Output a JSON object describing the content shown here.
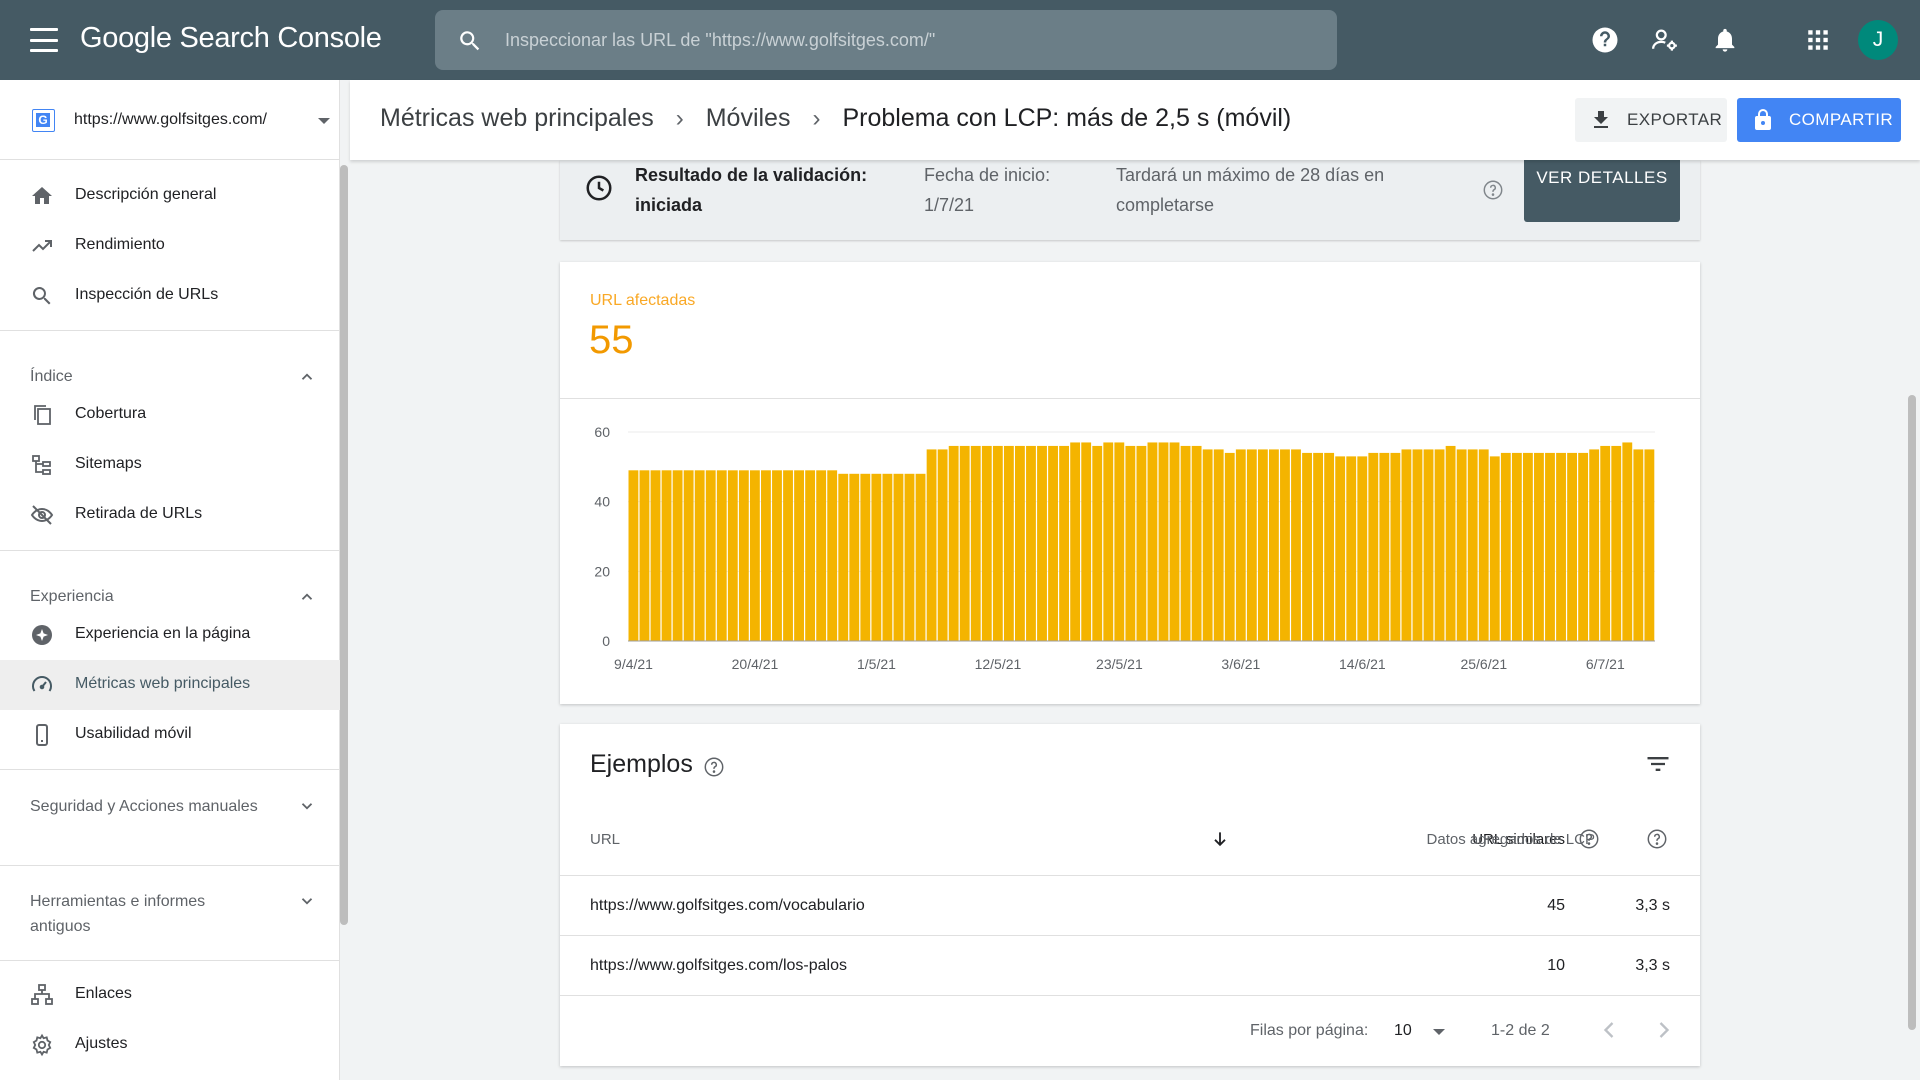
{
  "app": {
    "logo_text": "Google Search Console",
    "search_placeholder": "Inspeccionar las URL de \"https://www.golfsitges.com/\"",
    "avatar_letter": "J"
  },
  "icons": {
    "menu": "menu-icon",
    "search": "search-icon",
    "help": "help-icon",
    "user_settings": "manage-accounts-icon",
    "notifications": "bell-icon",
    "apps": "apps-grid-icon"
  },
  "sidebar": {
    "property_url": "https://www.golfsitges.com/",
    "property_icon_letter": "G",
    "top_items": [
      {
        "label": "Descripción general",
        "icon": "home-icon"
      },
      {
        "label": "Rendimiento",
        "icon": "trending-up-icon"
      },
      {
        "label": "Inspección de URLs",
        "icon": "search-icon"
      }
    ],
    "sections": [
      {
        "label": "Índice",
        "expanded": true
      },
      {
        "label": "Experiencia",
        "expanded": true
      },
      {
        "label": "Seguridad y Acciones manuales",
        "expanded": false
      },
      {
        "label": "Herramientas e informes antiguos",
        "expanded": false
      }
    ],
    "index_items": [
      {
        "label": "Cobertura",
        "icon": "copy-pages-icon"
      },
      {
        "label": "Sitemaps",
        "icon": "sitemap-icon"
      },
      {
        "label": "Retirada de URLs",
        "icon": "visibility-off-icon"
      }
    ],
    "experience_items": [
      {
        "label": "Experiencia en la página",
        "icon": "plus-circle-icon"
      },
      {
        "label": "Métricas web principales",
        "icon": "speedometer-icon",
        "active": true
      },
      {
        "label": "Usabilidad móvil",
        "icon": "smartphone-icon"
      }
    ],
    "bottom_items": [
      {
        "label": "Enlaces",
        "icon": "links-tree-icon"
      },
      {
        "label": "Ajustes",
        "icon": "settings-gear-icon"
      }
    ]
  },
  "header": {
    "breadcrumbs": [
      "Métricas web principales",
      "Móviles"
    ],
    "current": "Problema con LCP: más de 2,5 s (móvil)",
    "export_label": "EXPORTAR",
    "share_label": "COMPARTIR"
  },
  "validation": {
    "result_label": "Resultado de la validación: iniciada",
    "start_date_label": "Fecha de inicio: 1/7/21",
    "duration_text": "Tardará un máximo de 28 días en completarse",
    "details_button": "VER DETALLES"
  },
  "metric": {
    "label": "URL afectadas",
    "value": "55"
  },
  "colors": {
    "appbar": "#455a64",
    "bar": "#f4b400",
    "metric_value": "#f29900",
    "share_button": "#4285f4"
  },
  "chart_data": {
    "type": "bar",
    "ylim": [
      0,
      60
    ],
    "yticks": [
      0,
      20,
      40,
      60
    ],
    "xtick_labels": [
      "9/4/21",
      "20/4/21",
      "1/5/21",
      "12/5/21",
      "23/5/21",
      "3/6/21",
      "14/6/21",
      "25/6/21",
      "6/7/21"
    ],
    "xtick_indices": [
      0,
      11,
      22,
      33,
      44,
      55,
      66,
      77,
      88
    ],
    "series": [
      {
        "values": [
          49,
          49,
          49,
          49,
          49,
          49,
          49,
          49,
          49,
          49,
          49,
          49,
          49,
          49,
          49,
          49,
          49,
          49,
          49,
          48,
          48,
          48,
          48,
          48,
          48,
          48,
          48,
          55,
          55,
          56,
          56,
          56,
          56,
          56,
          56,
          56,
          56,
          56,
          56,
          56,
          57,
          57,
          56,
          57,
          57,
          56,
          56,
          57,
          57,
          57,
          56,
          56,
          55,
          55,
          54,
          55,
          55,
          55,
          55,
          55,
          55,
          54,
          54,
          54,
          53,
          53,
          53,
          54,
          54,
          54,
          55,
          55,
          55,
          55,
          56,
          55,
          55,
          55,
          53,
          54,
          54,
          54,
          54,
          54,
          54,
          54,
          54,
          55,
          56,
          56,
          57,
          55,
          55
        ]
      }
    ]
  },
  "examples": {
    "title": "Ejemplos",
    "columns": {
      "url": "URL",
      "similar": "URL similares",
      "lcp": "Datos agregados de LCP"
    },
    "rows": [
      {
        "url": "https://www.golfsitges.com/vocabulario",
        "similar": "45",
        "lcp": "3,3 s"
      },
      {
        "url": "https://www.golfsitges.com/los-palos",
        "similar": "10",
        "lcp": "3,3 s"
      }
    ],
    "rows_per_page_label": "Filas por página:",
    "rows_per_page_value": "10",
    "range_text": "1-2 de 2"
  }
}
